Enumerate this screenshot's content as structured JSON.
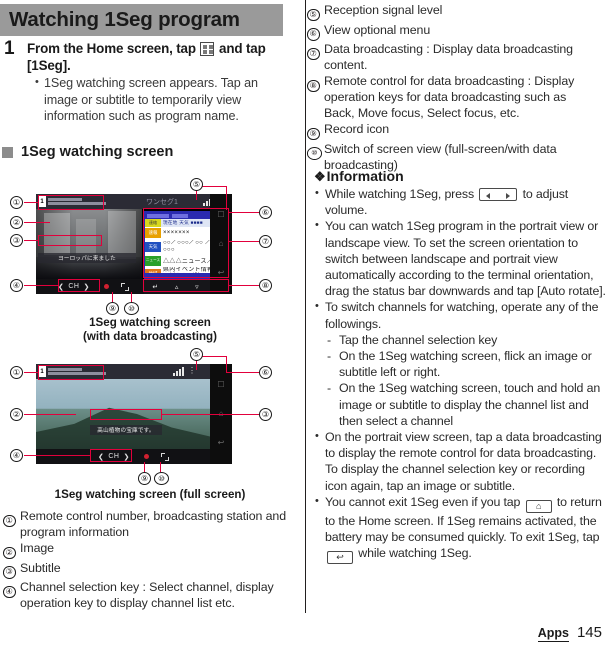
{
  "document": {
    "section_title": "Watching 1Seg program",
    "footer": {
      "chapter": "Apps",
      "page_number": "145"
    }
  },
  "step": {
    "number": "1",
    "heading_part1": "From the Home screen, tap",
    "heading_icon": "apps-grid-icon",
    "heading_part2": "and tap [1Seg].",
    "bullets": [
      "1Seg watching screen appears. Tap an image or subtitle to temporarily view information such as program name."
    ]
  },
  "subhead": {
    "label": "1Seg watching screen"
  },
  "figures": [
    {
      "caption_line1": "1Seg watching screen",
      "caption_line2": "(with data broadcasting)",
      "statusbar": {
        "channel_number": "1",
        "station_name": "テレビ○○○",
        "program_title": "○○○○○○○○○○",
        "app_label": "ワンセグ1",
        "signal_icon": "signal-bars-icon",
        "menu_icon": "overflow-menu-icon"
      },
      "subtitle_text": "ヨーロッパに来ました",
      "controls": {
        "prev_icon": "chevron-left-icon",
        "channel_label": "CH",
        "next_icon": "chevron-right-icon",
        "record_icon": "record-dot-icon",
        "expand_icon": "expand-screen-icon"
      },
      "data_broadcast": {
        "rows": [
          {
            "tag": "連絡",
            "text": "現在地 天気 ■■■■"
          },
          {
            "tag": "速報",
            "text": "×××××××"
          },
          {
            "tag": "天気",
            "text": "○○／○○○／○○ ／○○／○○○"
          },
          {
            "tag": "ニュース",
            "text": "△△△ニュース／全"
          },
          {
            "tag": "地域",
            "text": "県内イベント情報 市町村から／防災"
          }
        ],
        "remote_buttons": [
          "back-icon",
          "up-icon",
          "down-icon",
          "select-icon"
        ]
      }
    },
    {
      "caption_line1": "1Seg watching screen (full screen)",
      "caption_line2": "",
      "statusbar": {
        "channel_number": "1",
        "station_name": "テレビ○○○",
        "program_title": "○○○○○○○○○○",
        "signal_icon": "signal-bars-icon",
        "menu_icon": "overflow-menu-icon"
      },
      "subtitle_text": "高山植物の宝庫です。",
      "controls": {
        "prev_icon": "chevron-left-icon",
        "channel_label": "CH",
        "next_icon": "chevron-right-icon",
        "record_icon": "record-dot-icon",
        "expand_icon": "expand-screen-icon"
      }
    }
  ],
  "legend_left": [
    {
      "num": "①",
      "text": "Remote control number, broadcasting station and program information"
    },
    {
      "num": "②",
      "text": "Image"
    },
    {
      "num": "③",
      "text": "Subtitle"
    },
    {
      "num": "④",
      "text": "Channel selection key : Select channel, display operation key to display channel list etc."
    }
  ],
  "legend_right": [
    {
      "num": "⑤",
      "text": "Reception signal level"
    },
    {
      "num": "⑥",
      "text": "View optional menu"
    },
    {
      "num": "⑦",
      "text": "Data broadcasting : Display data broadcasting content."
    },
    {
      "num": "⑧",
      "text": "Remote control for data broadcasting : Display operation keys for data broadcasting such as Back, Move focus, Select focus, etc."
    },
    {
      "num": "⑨",
      "text": "Record icon"
    },
    {
      "num": "⑩",
      "text": "Switch of screen view (full-screen/with data broadcasting)"
    }
  ],
  "information": {
    "title": "Information",
    "diamond_icon": "diamond-bullet-icon",
    "items": [
      {
        "type": "bullet",
        "parts": [
          {
            "kind": "text",
            "value": "While watching 1Seg, press"
          },
          {
            "kind": "key",
            "value": "volume-key-icon"
          },
          {
            "kind": "text",
            "value": "to adjust volume."
          }
        ]
      },
      {
        "type": "bullet",
        "parts": [
          {
            "kind": "text",
            "value": "You can watch 1Seg program in the portrait view or landscape view. To set the screen orientation to switch between landscape and portrait view automatically according to the terminal orientation, drag the status bar downwards and tap [Auto rotate]."
          }
        ]
      },
      {
        "type": "bullet",
        "parts": [
          {
            "kind": "text",
            "value": "To switch channels for watching, operate any of the followings."
          }
        ]
      },
      {
        "type": "dash",
        "parts": [
          {
            "kind": "text",
            "value": "Tap the channel selection key"
          }
        ]
      },
      {
        "type": "dash",
        "parts": [
          {
            "kind": "text",
            "value": "On the 1Seg watching screen, flick an image or subtitle left or right."
          }
        ]
      },
      {
        "type": "dash",
        "parts": [
          {
            "kind": "text",
            "value": "On the 1Seg watching screen, touch and hold an image or subtitle to display the channel list and then select a channel"
          }
        ]
      },
      {
        "type": "bullet",
        "parts": [
          {
            "kind": "text",
            "value": "On the portrait view screen, tap a data broadcasting to display the remote control for data broadcasting. To display the channel selection key or recording icon again, tap an image or subtitle."
          }
        ]
      },
      {
        "type": "bullet",
        "parts": [
          {
            "kind": "text",
            "value": "You cannot exit 1Seg even if you tap"
          },
          {
            "kind": "key",
            "value": "home-key-icon"
          },
          {
            "kind": "text",
            "value": "to return to the Home screen. If 1Seg remains activated, the battery may be consumed quickly. To exit 1Seg, tap"
          },
          {
            "kind": "key",
            "value": "back-key-icon"
          },
          {
            "kind": "text",
            "value": "while watching 1Seg."
          }
        ]
      }
    ]
  },
  "colors": {
    "header_bar": "#9a9a9a",
    "annotation_red": "#e2003c",
    "text": "#231f20"
  }
}
